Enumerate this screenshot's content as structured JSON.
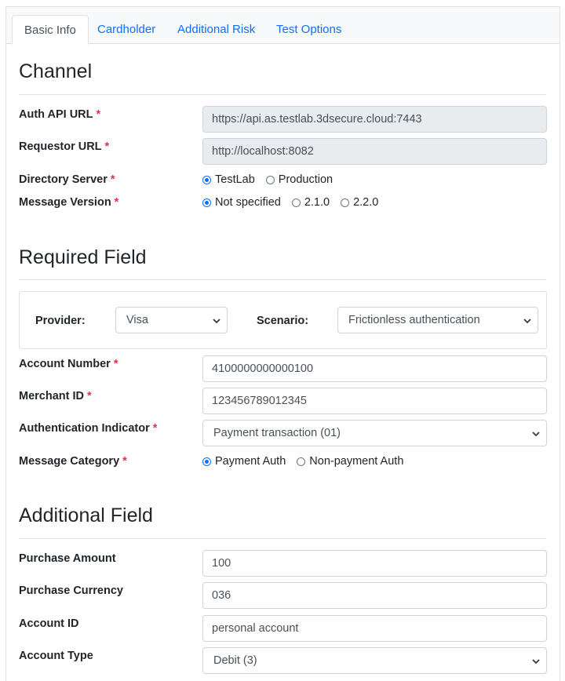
{
  "tabs": [
    {
      "label": "Basic Info",
      "active": true
    },
    {
      "label": "Cardholder",
      "active": false
    },
    {
      "label": "Additional Risk",
      "active": false
    },
    {
      "label": "Test Options",
      "active": false
    }
  ],
  "channel": {
    "title": "Channel",
    "auth_api_url": {
      "label": "Auth API URL",
      "value": "https://api.as.testlab.3dsecure.cloud:7443"
    },
    "requestor_url": {
      "label": "Requestor URL",
      "value": "http://localhost:8082"
    },
    "directory_server": {
      "label": "Directory Server",
      "options": [
        "TestLab",
        "Production"
      ],
      "selected": "TestLab"
    },
    "message_version": {
      "label": "Message Version",
      "options": [
        "Not specified",
        "2.1.0",
        "2.2.0"
      ],
      "selected": "Not specified"
    }
  },
  "required": {
    "title": "Required Field",
    "provider": {
      "label": "Provider:",
      "value": "Visa"
    },
    "scenario": {
      "label": "Scenario:",
      "value": "Frictionless authentication"
    },
    "account_number": {
      "label": "Account Number",
      "value": "4100000000000100"
    },
    "merchant_id": {
      "label": "Merchant ID",
      "value": "123456789012345"
    },
    "authentication_indicator": {
      "label": "Authentication Indicator",
      "value": "Payment transaction (01)"
    },
    "message_category": {
      "label": "Message Category",
      "options": [
        "Payment Auth",
        "Non-payment Auth"
      ],
      "selected": "Payment Auth"
    }
  },
  "additional": {
    "title": "Additional Field",
    "purchase_amount": {
      "label": "Purchase Amount",
      "value": "100"
    },
    "purchase_currency": {
      "label": "Purchase Currency",
      "value": "036"
    },
    "account_id": {
      "label": "Account ID",
      "value": "personal account"
    },
    "account_type": {
      "label": "Account Type",
      "value": "Debit (3)"
    }
  },
  "required_marker": "*",
  "colors": {
    "link": "#0d6efd",
    "required": "#dc3545",
    "readonly_bg": "#e9ecef",
    "border": "#dee2e6"
  },
  "icons": {
    "select_arrow": "chevron-down-icon",
    "radio": "radio-icon"
  }
}
